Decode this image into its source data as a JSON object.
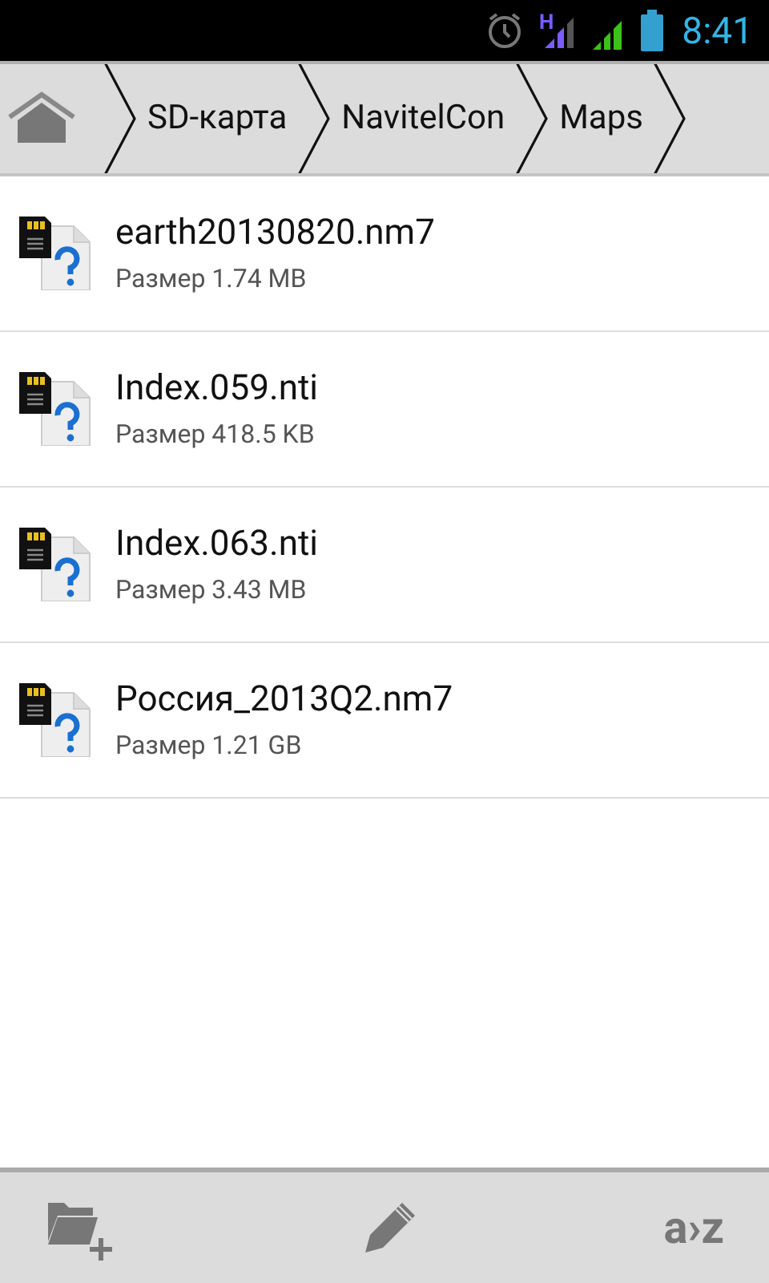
{
  "status_bar": {
    "time": "8:41",
    "network_type": "H"
  },
  "breadcrumbs": [
    {
      "label": "SD-карта"
    },
    {
      "label": "NavitelCon"
    },
    {
      "label": "Maps"
    }
  ],
  "files": [
    {
      "name": "earth20130820.nm7",
      "size": "Размер 1.74 MB"
    },
    {
      "name": "Index.059.nti",
      "size": "Размер 418.5 KB"
    },
    {
      "name": "Index.063.nti",
      "size": "Размер 3.43 MB"
    },
    {
      "name": "Россия_2013Q2.nm7",
      "size": "Размер 1.21 GB"
    }
  ],
  "toolbar": {
    "sort_label": "a›z"
  }
}
